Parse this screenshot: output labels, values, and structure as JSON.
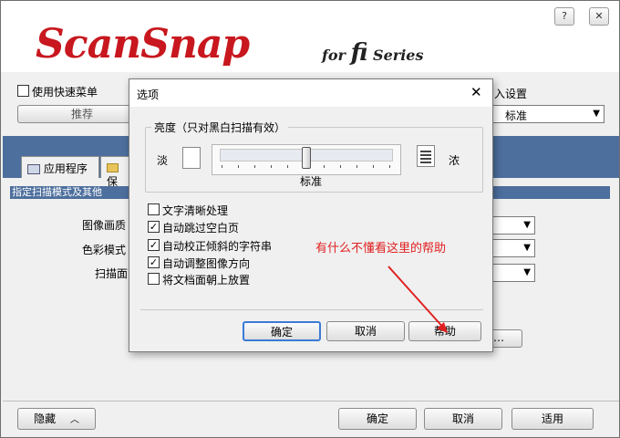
{
  "app": {
    "logo_text": "ScanSnap",
    "logo_for": "for",
    "logo_fi": "fi",
    "logo_series": "Series",
    "minimize_glyph": "?",
    "close_glyph": "✕"
  },
  "main": {
    "quick_menu_label": "使用快速菜单",
    "recommend_button": "推荐",
    "right_setting_label": "入设置",
    "right_setting_value": "标准",
    "tabs": [
      {
        "label": "应用程序",
        "icon": "scanner-icon"
      },
      {
        "label": "保",
        "icon": "folder-icon"
      }
    ],
    "info_bar": "指定扫描模式及其他",
    "fields": [
      {
        "label": "图像画质"
      },
      {
        "label": "色彩模式"
      },
      {
        "label": "扫描面"
      }
    ],
    "ellipsis_button": "…",
    "hide_button": "隐藏",
    "ok_button": "确定",
    "cancel_button": "取消",
    "apply_button": "适用"
  },
  "dialog": {
    "title": "选项",
    "close_glyph": "✕",
    "brightness_title": "亮度（只对黑白扫描有效）",
    "light_label": "淡",
    "dark_label": "浓",
    "slider_value_label": "标准",
    "slider_level": 0.5,
    "options": [
      {
        "label": "文字清晰处理",
        "checked": false
      },
      {
        "label": "自动跳过空白页",
        "checked": true
      },
      {
        "label": "自动校正倾斜的字符串",
        "checked": true
      },
      {
        "label": "自动调整图像方向",
        "checked": true
      },
      {
        "label": "将文档面朝上放置",
        "checked": false
      }
    ],
    "ok_button": "确定",
    "cancel_button": "取消",
    "help_button": "帮助"
  },
  "annotation": {
    "text": "有什么不懂看这里的帮助",
    "color": "#e02020"
  },
  "colors": {
    "brand_red": "#c8171e",
    "band_blue": "#4d6f9d"
  }
}
